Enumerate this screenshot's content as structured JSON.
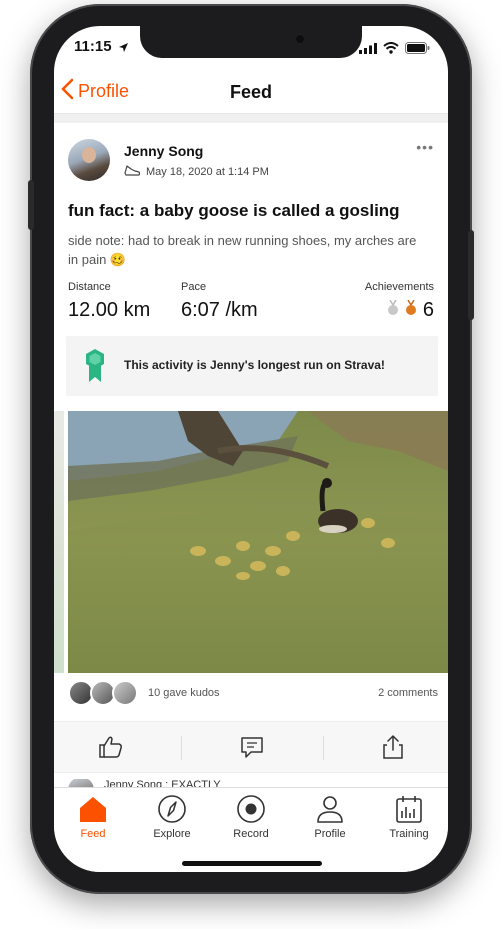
{
  "status_bar": {
    "time": "11:15"
  },
  "nav": {
    "back_label": "Profile",
    "title": "Feed"
  },
  "activity": {
    "athlete_name": "Jenny Song",
    "date": "May 18, 2020 at 1:14 PM",
    "title": "fun fact: a baby goose is called a gosling",
    "description": "side note: had to break in new running shoes, my arches are in pain 🥴",
    "stats": {
      "distance_label": "Distance",
      "distance_value": "12.00 km",
      "pace_label": "Pace",
      "pace_value": "6:07 /km",
      "achievements_label": "Achievements",
      "achievements_count": "6"
    },
    "achievement_banner": "This activity is Jenny's longest run on Strava!",
    "kudos_text": "10 gave kudos",
    "comments_text": "2 comments",
    "comment_preview": "Jenny Song : EXACTLY"
  },
  "tabs": [
    {
      "label": "Feed",
      "icon": "home-icon",
      "active": true
    },
    {
      "label": "Explore",
      "icon": "compass-icon",
      "active": false
    },
    {
      "label": "Record",
      "icon": "record-icon",
      "active": false
    },
    {
      "label": "Profile",
      "icon": "person-icon",
      "active": false
    },
    {
      "label": "Training",
      "icon": "calendar-icon",
      "active": false
    }
  ],
  "colors": {
    "brand": "#fc5200",
    "achievement_green": "#2bb585",
    "silver_medal": "#c8c8c8",
    "bronze_medal": "#e07a1f"
  }
}
